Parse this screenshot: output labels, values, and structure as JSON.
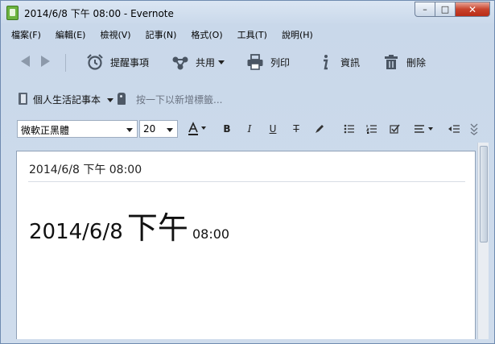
{
  "window": {
    "title": "2014/6/8 下午 08:00 - Evernote",
    "minimize": "–",
    "maximize": "□",
    "close": "✕"
  },
  "menu": [
    "檔案(F)",
    "編輯(E)",
    "檢視(V)",
    "記事(N)",
    "格式(O)",
    "工具(T)",
    "說明(H)"
  ],
  "toolbar": {
    "reminder": "提醒事項",
    "share": "共用",
    "print": "列印",
    "info": "資訊",
    "delete": "刪除"
  },
  "notebook": {
    "name": "個人生活記事本",
    "tag_hint": "按一下以新增標籤..."
  },
  "format": {
    "font": "微軟正黑體",
    "size": "20"
  },
  "note": {
    "title": "2014/6/8 下午 08:00",
    "body_date": "2014/6/8",
    "body_ampm": "下午",
    "body_time": "08:00"
  },
  "colors": {
    "accent": "#6cb33f",
    "close_button": "#c8432c"
  },
  "icons": [
    "app-icon",
    "back-arrow-icon",
    "forward-arrow-icon",
    "alarm-clock-icon",
    "share-icon",
    "printer-icon",
    "info-icon",
    "trash-icon",
    "notebook-icon",
    "tag-icon",
    "font-color-icon",
    "bold-icon",
    "italic-icon",
    "underline-icon",
    "strikethrough-icon",
    "highlighter-icon",
    "bulleted-list-icon",
    "numbered-list-icon",
    "checkbox-icon",
    "align-icon",
    "indent-icon",
    "more-icon"
  ]
}
